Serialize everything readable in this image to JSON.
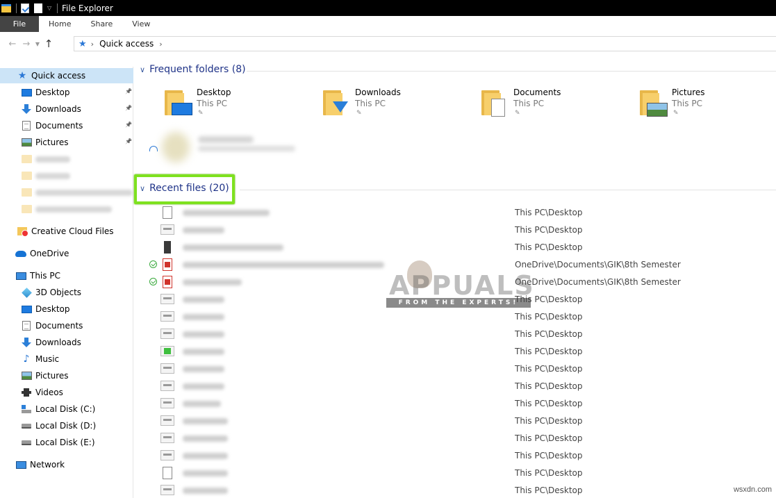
{
  "window": {
    "title": "File Explorer"
  },
  "ribbon": {
    "tabs": [
      "File",
      "Home",
      "Share",
      "View"
    ]
  },
  "address": {
    "path": [
      "Quick access"
    ]
  },
  "sidebar": {
    "items": [
      {
        "label": "Quick access",
        "icon": "quick-access-star-icon",
        "selected": true
      },
      {
        "label": "Desktop",
        "icon": "desktop-icon",
        "pinned": true
      },
      {
        "label": "Downloads",
        "icon": "downloads-icon",
        "pinned": true
      },
      {
        "label": "Documents",
        "icon": "documents-icon",
        "pinned": true
      },
      {
        "label": "Pictures",
        "icon": "pictures-icon",
        "pinned": true
      },
      {
        "label": "",
        "icon": "folder-icon",
        "blurred": true
      },
      {
        "label": "",
        "icon": "folder-icon",
        "blurred": true
      },
      {
        "label": "",
        "icon": "folder-icon",
        "blurred": true
      },
      {
        "label": "",
        "icon": "folder-icon",
        "blurred": true
      },
      {
        "label": "Creative Cloud Files",
        "icon": "creative-cloud-folder-icon"
      },
      {
        "label": "OneDrive",
        "icon": "onedrive-cloud-icon"
      },
      {
        "label": "This PC",
        "icon": "this-pc-icon"
      },
      {
        "label": "3D Objects",
        "icon": "3d-objects-icon"
      },
      {
        "label": "Desktop",
        "icon": "desktop-icon"
      },
      {
        "label": "Documents",
        "icon": "documents-icon"
      },
      {
        "label": "Downloads",
        "icon": "downloads-icon"
      },
      {
        "label": "Music",
        "icon": "music-icon"
      },
      {
        "label": "Pictures",
        "icon": "pictures-icon"
      },
      {
        "label": "Videos",
        "icon": "videos-icon"
      },
      {
        "label": "Local Disk (C:)",
        "icon": "local-disk-c-icon"
      },
      {
        "label": "Local Disk (D:)",
        "icon": "local-disk-icon"
      },
      {
        "label": "Local Disk (E:)",
        "icon": "local-disk-icon"
      },
      {
        "label": "Network",
        "icon": "network-icon"
      }
    ]
  },
  "frequent": {
    "header": "Frequent folders (8)",
    "folders": [
      {
        "name": "Desktop",
        "location": "This PC",
        "overlay": "desktop"
      },
      {
        "name": "Downloads",
        "location": "This PC",
        "overlay": "downloads"
      },
      {
        "name": "Documents",
        "location": "This PC",
        "overlay": "documents"
      },
      {
        "name": "Pictures",
        "location": "This PC",
        "overlay": "pictures"
      }
    ]
  },
  "recent": {
    "header": "Recent files (20)",
    "files": [
      {
        "thumb": "doc",
        "location": "This PC\\Desktop",
        "synced": false
      },
      {
        "thumb": "img",
        "location": "This PC\\Desktop",
        "synced": false
      },
      {
        "thumb": "dark",
        "location": "This PC\\Desktop",
        "synced": false
      },
      {
        "thumb": "pdf",
        "location": "OneDrive\\Documents\\GIK\\8th Semester",
        "synced": true
      },
      {
        "thumb": "pdf",
        "location": "OneDrive\\Documents\\GIK\\8th Semester",
        "synced": true
      },
      {
        "thumb": "img",
        "location": "This PC\\Desktop",
        "synced": false
      },
      {
        "thumb": "img",
        "location": "This PC\\Desktop",
        "synced": false
      },
      {
        "thumb": "img",
        "location": "This PC\\Desktop",
        "synced": false
      },
      {
        "thumb": "green",
        "location": "This PC\\Desktop",
        "synced": false
      },
      {
        "thumb": "img",
        "location": "This PC\\Desktop",
        "synced": false
      },
      {
        "thumb": "img",
        "location": "This PC\\Desktop",
        "synced": false
      },
      {
        "thumb": "img",
        "location": "This PC\\Desktop",
        "synced": false
      },
      {
        "thumb": "img",
        "location": "This PC\\Desktop",
        "synced": false
      },
      {
        "thumb": "img",
        "location": "This PC\\Desktop",
        "synced": false
      },
      {
        "thumb": "img",
        "location": "This PC\\Desktop",
        "synced": false
      },
      {
        "thumb": "doc",
        "location": "This PC\\Desktop",
        "synced": false
      },
      {
        "thumb": "img",
        "location": "This PC\\Desktop",
        "synced": false
      }
    ]
  },
  "watermark": {
    "brand": "APPUALS",
    "tagline": "FROM THE EXPERTS!"
  },
  "site": "wsxdn.com",
  "colors": {
    "accent": "#1e3287",
    "highlight": "#7ee11f",
    "selection": "#cce4f7"
  }
}
